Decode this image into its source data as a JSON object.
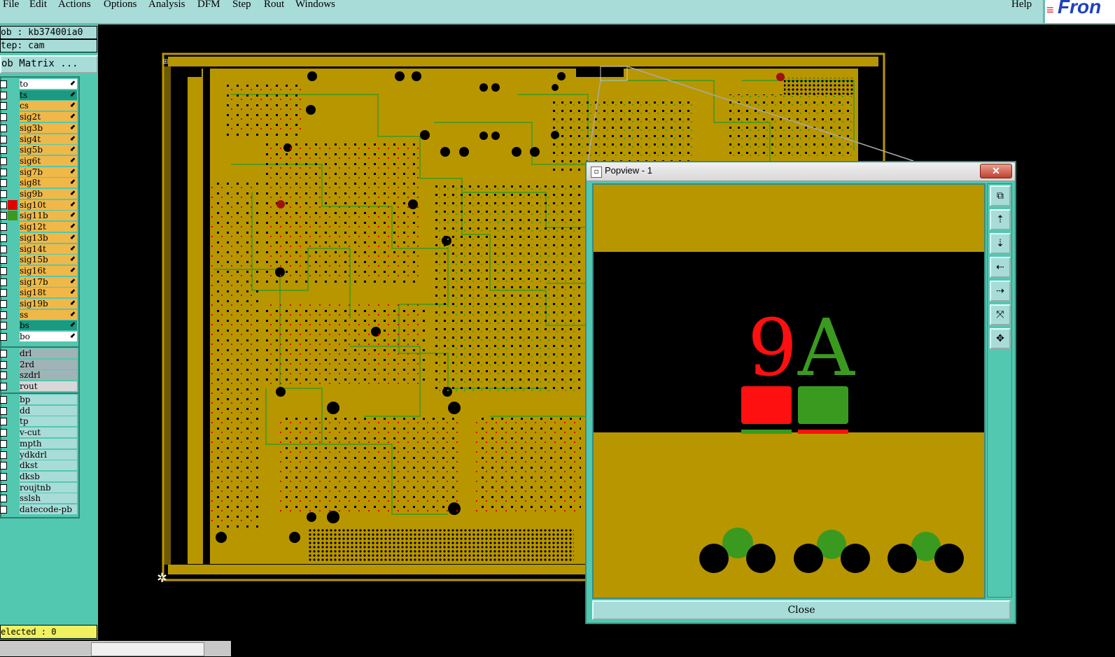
{
  "menubar": {
    "items": [
      "File",
      "Edit",
      "Actions",
      "Options",
      "Analysis",
      "DFM",
      "Step",
      "Rout",
      "Windows"
    ],
    "help": "Help",
    "logo_text": "Fron"
  },
  "left_panel": {
    "job": "ob : kb37400ia0",
    "step": "tep: cam",
    "matrix_button": "ob Matrix ...",
    "selected": "elected : 0"
  },
  "layers_signal": [
    {
      "name": "to",
      "bg": "#ffffff",
      "color": null
    },
    {
      "name": "ts",
      "bg": "#1a9a80",
      "color": null
    },
    {
      "name": "cs",
      "bg": "#f0b848",
      "color": null
    },
    {
      "name": "sig2t",
      "bg": "#f0b848",
      "color": null
    },
    {
      "name": "sig3b",
      "bg": "#f0b848",
      "color": null
    },
    {
      "name": "sig4t",
      "bg": "#f0b848",
      "color": null
    },
    {
      "name": "sig5b",
      "bg": "#f0b848",
      "color": null
    },
    {
      "name": "sig6t",
      "bg": "#f0b848",
      "color": null
    },
    {
      "name": "sig7b",
      "bg": "#f0b848",
      "color": null
    },
    {
      "name": "sig8t",
      "bg": "#f0b848",
      "color": null
    },
    {
      "name": "sig9b",
      "bg": "#f0b848",
      "color": null
    },
    {
      "name": "sig10t",
      "bg": "#f0b848",
      "color": "#e00000"
    },
    {
      "name": "sig11b",
      "bg": "#f0b848",
      "color": "#3a9a20"
    },
    {
      "name": "sig12t",
      "bg": "#f0b848",
      "color": null
    },
    {
      "name": "sig13b",
      "bg": "#f0b848",
      "color": null
    },
    {
      "name": "sig14t",
      "bg": "#f0b848",
      "color": null
    },
    {
      "name": "sig15b",
      "bg": "#f0b848",
      "color": null
    },
    {
      "name": "sig16t",
      "bg": "#f0b848",
      "color": null
    },
    {
      "name": "sig17b",
      "bg": "#f0b848",
      "color": null
    },
    {
      "name": "sig18t",
      "bg": "#f0b848",
      "color": null
    },
    {
      "name": "sig19b",
      "bg": "#f0b848",
      "color": null
    },
    {
      "name": "ss",
      "bg": "#f0b848",
      "color": null
    },
    {
      "name": "bs",
      "bg": "#1a9a80",
      "color": null
    },
    {
      "name": "bo",
      "bg": "#ffffff",
      "color": null
    }
  ],
  "layers_drill": [
    {
      "name": "drl",
      "bg": "#a0b4b8"
    },
    {
      "name": "2rd",
      "bg": "#a0b4b8"
    },
    {
      "name": "szdrl",
      "bg": "#a0b4b8"
    },
    {
      "name": "rout",
      "bg": "#d8d8d8"
    }
  ],
  "layers_misc": [
    {
      "name": "bp"
    },
    {
      "name": "dd"
    },
    {
      "name": "tp"
    },
    {
      "name": "v-cut"
    },
    {
      "name": "mpth"
    },
    {
      "name": "ydkdrl"
    },
    {
      "name": "dkst"
    },
    {
      "name": "dksb"
    },
    {
      "name": "roujtnb"
    },
    {
      "name": "sslsh"
    },
    {
      "name": "datecode-pb"
    }
  ],
  "popview": {
    "title": "Popview - 1",
    "close_label": "Close",
    "text_red": "9",
    "text_green": "A"
  },
  "colors": {
    "board": "#b89600",
    "trace_green": "#3a9a20",
    "pad_red": "#e00000",
    "teal_panel": "#52c8b0",
    "menubar": "#a8dcd8"
  }
}
